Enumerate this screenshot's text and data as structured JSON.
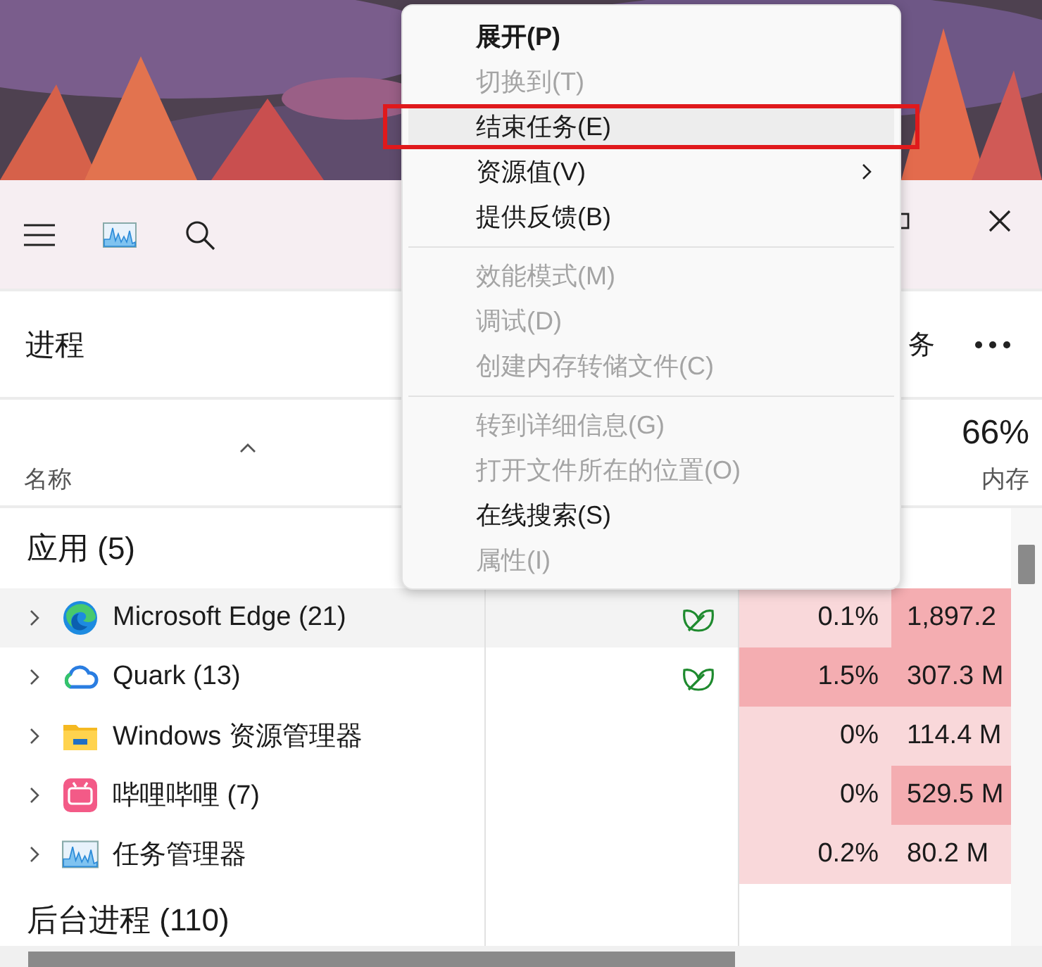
{
  "header": {
    "title": "进程",
    "action": "务"
  },
  "columns": {
    "name": "名称",
    "memory_percent": "66%",
    "memory": "内存"
  },
  "groups": [
    {
      "title": "应用 (5)",
      "rows": [
        {
          "kind": "edge",
          "name": "Microsoft Edge (21)",
          "selected": true,
          "efficiency": true,
          "cpu": {
            "text": "0.1%",
            "color": "#f9d8da"
          },
          "memory": {
            "text": "1,897.2",
            "color": "#f4adb1"
          }
        },
        {
          "kind": "quark",
          "name": "Quark (13)",
          "selected": false,
          "efficiency": true,
          "cpu": {
            "text": "1.5%",
            "color": "#f4adb1"
          },
          "memory": {
            "text": "307.3 M",
            "color": "#f4adb1"
          }
        },
        {
          "kind": "folder",
          "name": "Windows 资源管理器",
          "selected": false,
          "efficiency": false,
          "cpu": {
            "text": "0%",
            "color": "#f9d8da"
          },
          "memory": {
            "text": "114.4 M",
            "color": "#f9d8da"
          }
        },
        {
          "kind": "bilibili",
          "name": "哔哩哔哩 (7)",
          "selected": false,
          "efficiency": false,
          "cpu": {
            "text": "0%",
            "color": "#f9d8da"
          },
          "memory": {
            "text": "529.5 M",
            "color": "#f4adb1"
          }
        },
        {
          "kind": "monitor",
          "name": "任务管理器",
          "selected": false,
          "efficiency": false,
          "cpu": {
            "text": "0.2%",
            "color": "#f9d8da"
          },
          "memory": {
            "text": "80.2 M",
            "color": "#f9d8da"
          }
        }
      ]
    },
    {
      "title": "后台进程 (110)"
    }
  ],
  "context_menu": {
    "items": [
      {
        "kind": "item",
        "label": "展开(P)",
        "default": true,
        "disabled": false,
        "highlighted": false,
        "submenu": false
      },
      {
        "kind": "item",
        "label": "切换到(T)",
        "default": false,
        "disabled": true,
        "highlighted": false,
        "submenu": false
      },
      {
        "kind": "item",
        "label": "结束任务(E)",
        "default": false,
        "disabled": false,
        "highlighted": true,
        "submenu": false
      },
      {
        "kind": "item",
        "label": "资源值(V)",
        "default": false,
        "disabled": false,
        "highlighted": false,
        "submenu": true
      },
      {
        "kind": "item",
        "label": "提供反馈(B)",
        "default": false,
        "disabled": false,
        "highlighted": false,
        "submenu": false
      },
      {
        "kind": "separator"
      },
      {
        "kind": "item",
        "label": "效能模式(M)",
        "default": false,
        "disabled": true,
        "highlighted": false,
        "submenu": false
      },
      {
        "kind": "item",
        "label": "调试(D)",
        "default": false,
        "disabled": true,
        "highlighted": false,
        "submenu": false
      },
      {
        "kind": "item",
        "label": "创建内存转储文件(C)",
        "default": false,
        "disabled": true,
        "highlighted": false,
        "submenu": false
      },
      {
        "kind": "separator"
      },
      {
        "kind": "item",
        "label": "转到详细信息(G)",
        "default": false,
        "disabled": true,
        "highlighted": false,
        "submenu": false
      },
      {
        "kind": "item",
        "label": "打开文件所在的位置(O)",
        "default": false,
        "disabled": true,
        "highlighted": false,
        "submenu": false
      },
      {
        "kind": "item",
        "label": "在线搜索(S)",
        "default": false,
        "disabled": false,
        "highlighted": false,
        "submenu": false
      },
      {
        "kind": "item",
        "label": "属性(I)",
        "default": false,
        "disabled": true,
        "highlighted": false,
        "submenu": false
      }
    ]
  }
}
